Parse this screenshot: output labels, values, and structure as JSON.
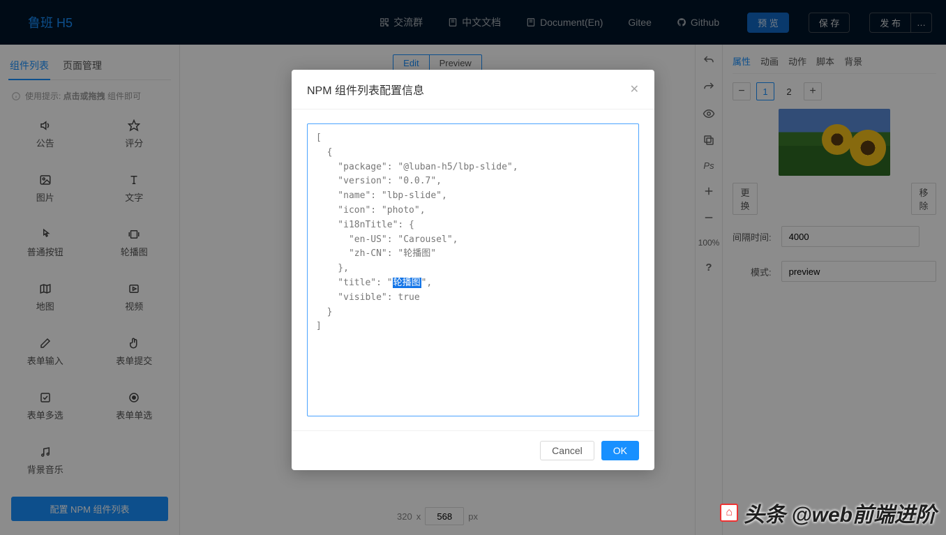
{
  "brand": "鲁班 H5",
  "topnav": {
    "chat": "交流群",
    "doc_cn": "中文文档",
    "doc_en": "Document(En)",
    "gitee": "Gitee",
    "github": "Github"
  },
  "top_actions": {
    "preview": "预 览",
    "save": "保 存",
    "publish": "发 布",
    "more": "…"
  },
  "left": {
    "tab_components": "组件列表",
    "tab_pages": "页面管理",
    "hint_prefix": "使用提示: ",
    "hint_bold": "点击或拖拽",
    "hint_suffix": " 组件即可",
    "components": {
      "announce": "公告",
      "rate": "评分",
      "image": "图片",
      "text": "文字",
      "button": "普通按钮",
      "slide": "轮播图",
      "map": "地图",
      "video": "视频",
      "form_input": "表单输入",
      "form_submit": "表单提交",
      "form_check": "表单多选",
      "form_radio": "表单单选",
      "bgm": "背景音乐"
    },
    "config_btn": "配置 NPM 组件列表"
  },
  "center": {
    "tab_edit": "Edit",
    "tab_preview": "Preview",
    "width": "320",
    "times": "x",
    "height": "568",
    "unit": "px"
  },
  "rstrip": {
    "zoom": "100%"
  },
  "right": {
    "tabs": {
      "attr": "属性",
      "anim": "动画",
      "action": "动作",
      "script": "脚本",
      "bg": "背景"
    },
    "pager": {
      "p1": "1",
      "p2": "2"
    },
    "change": "更 换",
    "remove": "移 除",
    "interval_label": "间隔时间:",
    "interval_value": "4000",
    "mode_label": "模式:",
    "mode_value": "preview"
  },
  "modal": {
    "title": "NPM 组件列表配置信息",
    "cancel": "Cancel",
    "ok": "OK",
    "json": {
      "l1": "[",
      "l2": "  {",
      "l3": "    \"package\": \"@luban-h5/lbp-slide\",",
      "l4": "    \"version\": \"0.0.7\",",
      "l5": "    \"name\": \"lbp-slide\",",
      "l6": "    \"icon\": \"photo\",",
      "l7": "    \"i18nTitle\": {",
      "l8": "      \"en-US\": \"Carousel\",",
      "l9": "      \"zh-CN\": \"轮播图\"",
      "l10": "    },",
      "l11a": "    \"title\": \"",
      "l11b": "轮播图",
      "l11c": "\",",
      "l12": "    \"visible\": true",
      "l13": "  }",
      "l14": "]"
    }
  },
  "watermark": "头条 @web前端进阶"
}
